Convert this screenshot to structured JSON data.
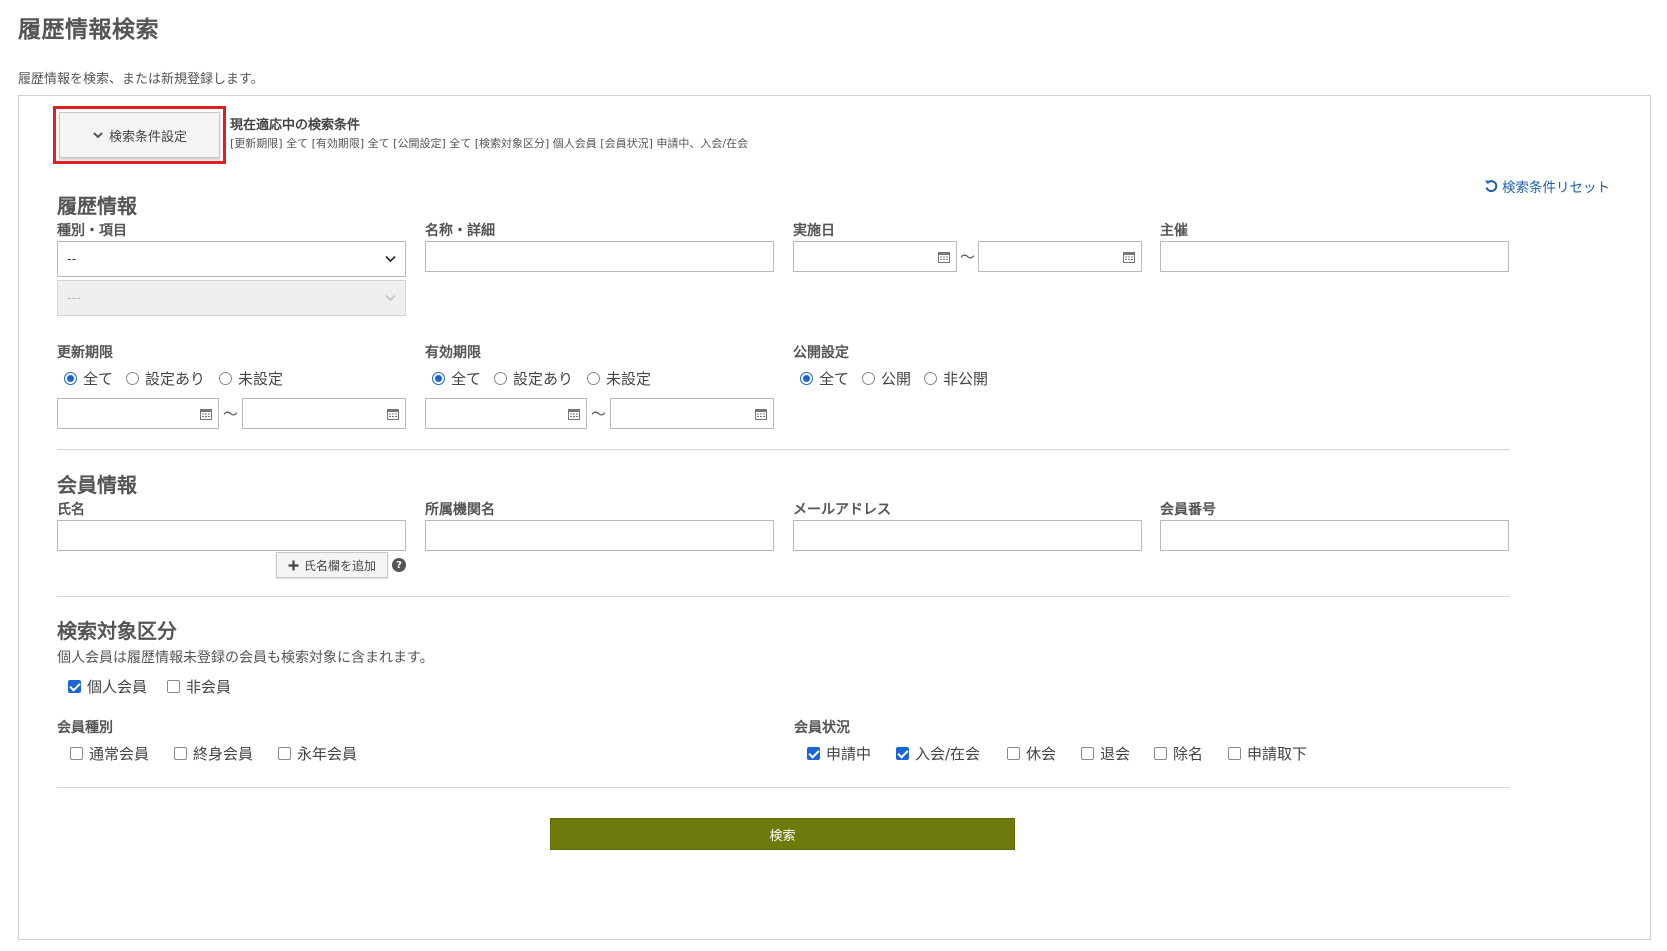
{
  "page": {
    "title": "履歴情報検索",
    "description": "履歴情報を検索、または新規登録します。"
  },
  "conditions": {
    "toggle_label": "検索条件設定",
    "current_title": "現在適応中の検索条件",
    "current_summary": "[更新期限] 全て [有効期限] 全て [公開設定] 全て [検索対象区分] 個人会員 [会員状況] 申請中、入会/在会",
    "reset_label": "検索条件リセット"
  },
  "history": {
    "section_title": "履歴情報",
    "type_label": "種別・項目",
    "type_value": "--",
    "subtype_value": "---",
    "name_label": "名称・詳細",
    "date_label": "実施日",
    "range_sep": "～",
    "host_label": "主催",
    "renewal_label": "更新期限",
    "validity_label": "有効期限",
    "publish_label": "公開設定",
    "opt_all": "全て",
    "opt_set": "設定あり",
    "opt_unset": "未設定",
    "opt_public": "公開",
    "opt_private": "非公開"
  },
  "member": {
    "section_title": "会員情報",
    "name_label": "氏名",
    "org_label": "所属機関名",
    "email_label": "メールアドレス",
    "number_label": "会員番号",
    "add_name_label": "氏名欄を追加",
    "help_glyph": "?"
  },
  "target": {
    "section_title": "検索対象区分",
    "note": "個人会員は履歴情報未登録の会員も検索対象に含まれます。",
    "opt_individual": "個人会員",
    "opt_nonmember": "非会員",
    "type_label": "会員種別",
    "opt_regular": "通常会員",
    "opt_lifetime": "終身会員",
    "opt_perpetual": "永年会員",
    "status_label": "会員状況",
    "opt_applying": "申請中",
    "opt_joined": "入会/在会",
    "opt_suspended": "休会",
    "opt_withdrawn": "退会",
    "opt_expelled": "除名",
    "opt_cancelled": "申請取下"
  },
  "actions": {
    "search_label": "検索"
  },
  "colors": {
    "accent_blue": "#1a66d6",
    "link_blue": "#1e5fb3",
    "search_button": "#6e7b0c",
    "highlight_border": "#e02020"
  }
}
